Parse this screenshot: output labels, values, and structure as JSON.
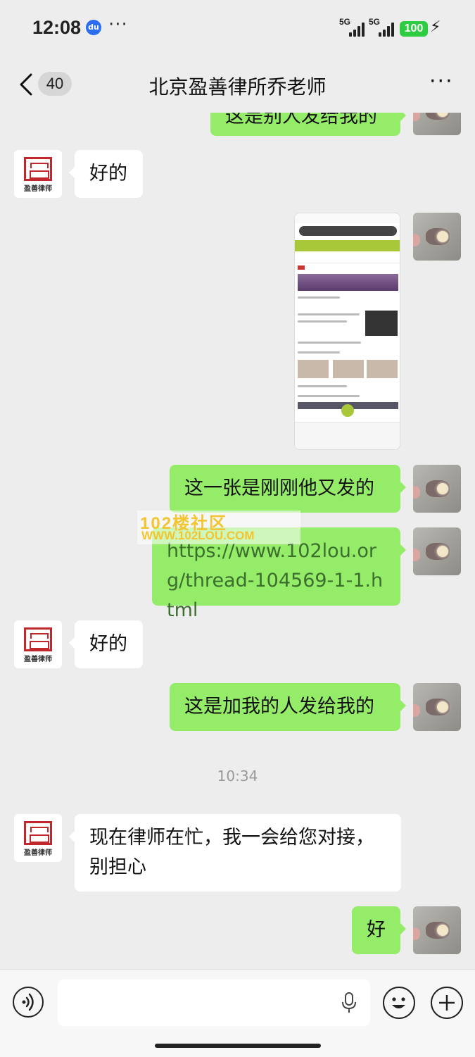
{
  "status_bar": {
    "time": "12:08",
    "app_icon": "baidu-icon",
    "dots": "···",
    "signal1_label": "5G",
    "signal2_label": "5G",
    "battery": "100"
  },
  "header": {
    "back_count": "40",
    "title": "北京盈善律所乔老师",
    "more": "···"
  },
  "avatars": {
    "lawyer_caption": "盈善律师"
  },
  "messages": {
    "m0": "这是别人发给我的",
    "m1": "好的",
    "m3": "这一张是刚刚他又发的",
    "m4": "https://www.102lou.org/thread-104569-1-1.html",
    "m5": "好的",
    "m6": "这是加我的人发给我的",
    "m7": "现在律师在忙，我一会给您对接，别担心",
    "m8": "好"
  },
  "timestamp": "10:34",
  "watermark": {
    "line1": "102楼社区",
    "line2": "WWW.102LOU.COM"
  },
  "colors": {
    "outgoing_bubble": "#95ec69",
    "incoming_bubble": "#ffffff",
    "background": "#ededed",
    "seal_red": "#c0282d"
  }
}
